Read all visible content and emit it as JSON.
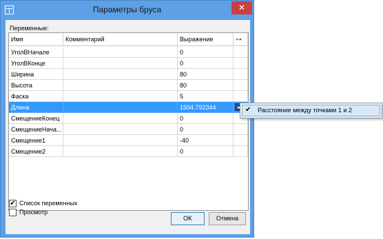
{
  "window": {
    "title": "Параметры бруса",
    "close_glyph": "✕"
  },
  "variables_label": "Переменные:",
  "columns": [
    "Имя",
    "Комментарий",
    "Выражение",
    "⊶"
  ],
  "rows": [
    {
      "name": "УголВНачале",
      "comment": "",
      "expression": "0"
    },
    {
      "name": "УголВКонце",
      "comment": "",
      "expression": "0"
    },
    {
      "name": "Ширина",
      "comment": "",
      "expression": "80"
    },
    {
      "name": "Высота",
      "comment": "",
      "expression": "80"
    },
    {
      "name": "Фаска",
      "comment": "",
      "expression": "5"
    },
    {
      "name": "Длина",
      "comment": "",
      "expression": "1504.792344"
    },
    {
      "name": "СмещениеКонец",
      "comment": "",
      "expression": "0"
    },
    {
      "name": "СмещениеНача...",
      "comment": "",
      "expression": "0"
    },
    {
      "name": "Смещение1",
      "comment": "",
      "expression": "-40"
    },
    {
      "name": "Смещение2",
      "comment": "",
      "expression": "0"
    }
  ],
  "selected_row_index": 5,
  "checkboxes": {
    "variables_list": {
      "label": "Список переменных",
      "checked": true
    },
    "preview": {
      "label": "Просмотр",
      "checked": false
    }
  },
  "buttons": {
    "ok": "OK",
    "cancel": "Отмена"
  },
  "popup": {
    "item_label": "Расстояние между точками 1 и 2",
    "checked": true
  },
  "glyphs": {
    "check": "✔"
  },
  "colors": {
    "titlebar": "#5da0e6",
    "selection": "#3399ff",
    "close": "#c94040"
  }
}
